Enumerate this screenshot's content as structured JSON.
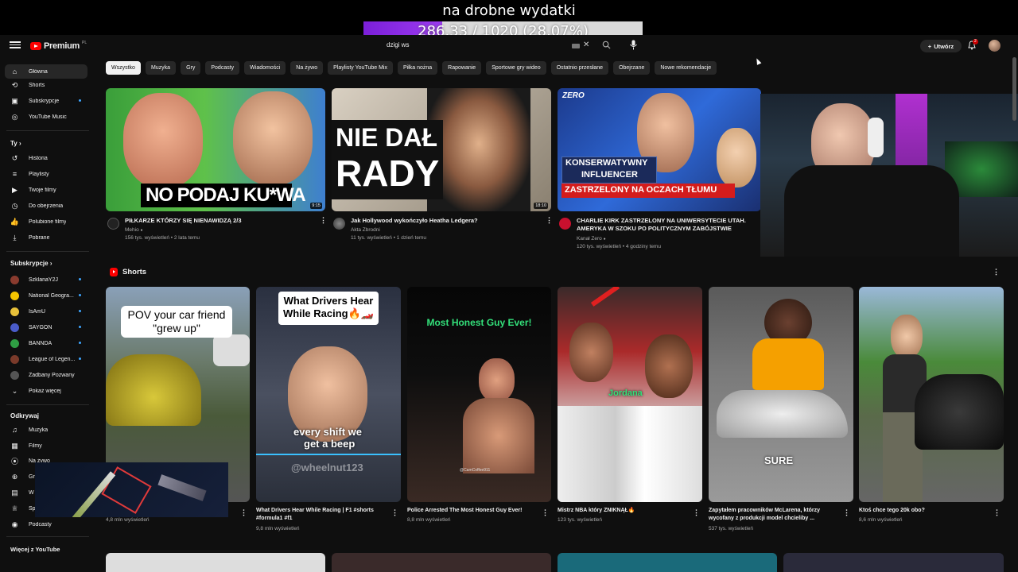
{
  "overlay": {
    "title": "na drobne wydatki",
    "progress_text": "286.33 / 1020 (28.07%)",
    "progress_fraction": 0.2807
  },
  "header": {
    "logo_text": "Premium",
    "logo_cc": "PL",
    "search_value": "dzigi ws",
    "create_label": "Utwórz",
    "notif_count": "2"
  },
  "sidebar": {
    "main": [
      {
        "label": "Główna",
        "icon": "home-icon"
      },
      {
        "label": "Shorts",
        "icon": "shorts-icon"
      },
      {
        "label": "Subskrypcje",
        "icon": "subscriptions-icon"
      },
      {
        "label": "YouTube Music",
        "icon": "music-icon"
      }
    ],
    "you_heading": "Ty",
    "you": [
      {
        "label": "Historia",
        "icon": "history-icon"
      },
      {
        "label": "Playlisty",
        "icon": "playlist-icon"
      },
      {
        "label": "Twoje filmy",
        "icon": "your-videos-icon"
      },
      {
        "label": "Do obejrzenia",
        "icon": "watch-later-icon"
      },
      {
        "label": "Polubione filmy",
        "icon": "like-icon"
      },
      {
        "label": "Pobrane",
        "icon": "download-icon"
      }
    ],
    "subs_heading": "Subskrypcje",
    "subs": [
      {
        "label": "SzklanaY2J",
        "color": "#8a3b2e"
      },
      {
        "label": "National Geogra...",
        "color": "#f5c400"
      },
      {
        "label": "IsAmU",
        "color": "#e8c13a"
      },
      {
        "label": "SAYGON",
        "color": "#4a5cc9"
      },
      {
        "label": "BANNDA",
        "color": "#2f9e44"
      },
      {
        "label": "League of Legen...",
        "color": "#7a3a2a"
      },
      {
        "label": "Zadbany Pozwany",
        "color": "#555555"
      }
    ],
    "show_more": "Pokaż więcej",
    "explore_heading": "Odkrywaj",
    "explore": [
      {
        "label": "Muzyka",
        "icon": "music-note-icon"
      },
      {
        "label": "Filmy",
        "icon": "film-icon"
      },
      {
        "label": "Na żywo",
        "icon": "live-icon"
      },
      {
        "label": "Gr",
        "icon": "gaming-icon"
      },
      {
        "label": "W",
        "icon": "news-icon"
      },
      {
        "label": "Sp",
        "icon": "sports-icon"
      },
      {
        "label": "Podcasty",
        "icon": "podcast-icon"
      }
    ],
    "more_heading": "Więcej z YouTube"
  },
  "chips": [
    "Wszystko",
    "Muzyka",
    "Gry",
    "Podcasty",
    "Wiadomości",
    "Na żywo",
    "Playlisty YouTube Mix",
    "Piłka nożna",
    "Rapowanie",
    "Sportowe gry wideo",
    "Ostatnio przesłane",
    "Obejrzane",
    "Nowe rekomendacje"
  ],
  "videos": [
    {
      "title": "PIŁKARZE KTÓRZY SIĘ NIENAWIDZĄ 2/3",
      "channel": "Mehio",
      "meta": "156 tys. wyświetleń • 2 lata temu",
      "duration": "9:15",
      "thumb_text": "NO PODAJ KU*WA"
    },
    {
      "title": "Jak Hollywood wykończyło Heatha Ledgera?",
      "channel": "Akta Zbrodni",
      "meta": "11 tys. wyświetleń • 1 dzień temu",
      "duration": "18:10",
      "thumb_text1": "NIE DAŁ",
      "thumb_text2": "RADY"
    },
    {
      "title1": "CHARLIE KIRK ZASTRZELONY NA UNIWERSYTECIE UTAH.",
      "title2": "AMERYKA W SZOKU PO POLITYCZNYM ZABÓJSTWIE",
      "channel": "Kanał Zero",
      "meta": "120 tys. wyświetleń • 4 godziny temu",
      "thumb_brand": "ZERO",
      "thumb_text1": "KONSERWATYWNY",
      "thumb_text2": "INFLUENCER",
      "thumb_text3": "ZASTRZELONY NA OCZACH TŁUMU"
    }
  ],
  "shorts_heading": "Shorts",
  "shorts": [
    {
      "caption": "POV your car friend \"grew up\"",
      "title": "",
      "meta": "4,8 mln wyświetleń"
    },
    {
      "caption1": "What Drivers Hear",
      "caption2": "While Racing🔥🏎️",
      "caption3": "every shift we",
      "caption4": "get a beep",
      "watermark": "@wheelnut123",
      "title1": "What Drivers Hear While Racing | F1 #shorts",
      "title2": "#formula1 #f1",
      "meta": "9,8 mln wyświetleń"
    },
    {
      "caption": "Most Honest Guy Ever!",
      "watermark": "@CamCoffee911",
      "title": "Police Arrested The Most Honest Guy Ever!",
      "meta": "8,8 mln wyświetleń"
    },
    {
      "caption": "Jordana",
      "title": "Mistrz NBA który ZNIKNĄŁ🔥",
      "meta": "123 tys. wyświetleń"
    },
    {
      "caption": "SURE",
      "title1": "Zapytałem pracowników McLarena, którzy",
      "title2": "wycofany z produkcji model chcieliby ...",
      "meta": "537 tys. wyświetleń"
    },
    {
      "title": "Ktoś chce tego 20k obo?",
      "meta": "8,6 mln wyświetleń"
    }
  ]
}
